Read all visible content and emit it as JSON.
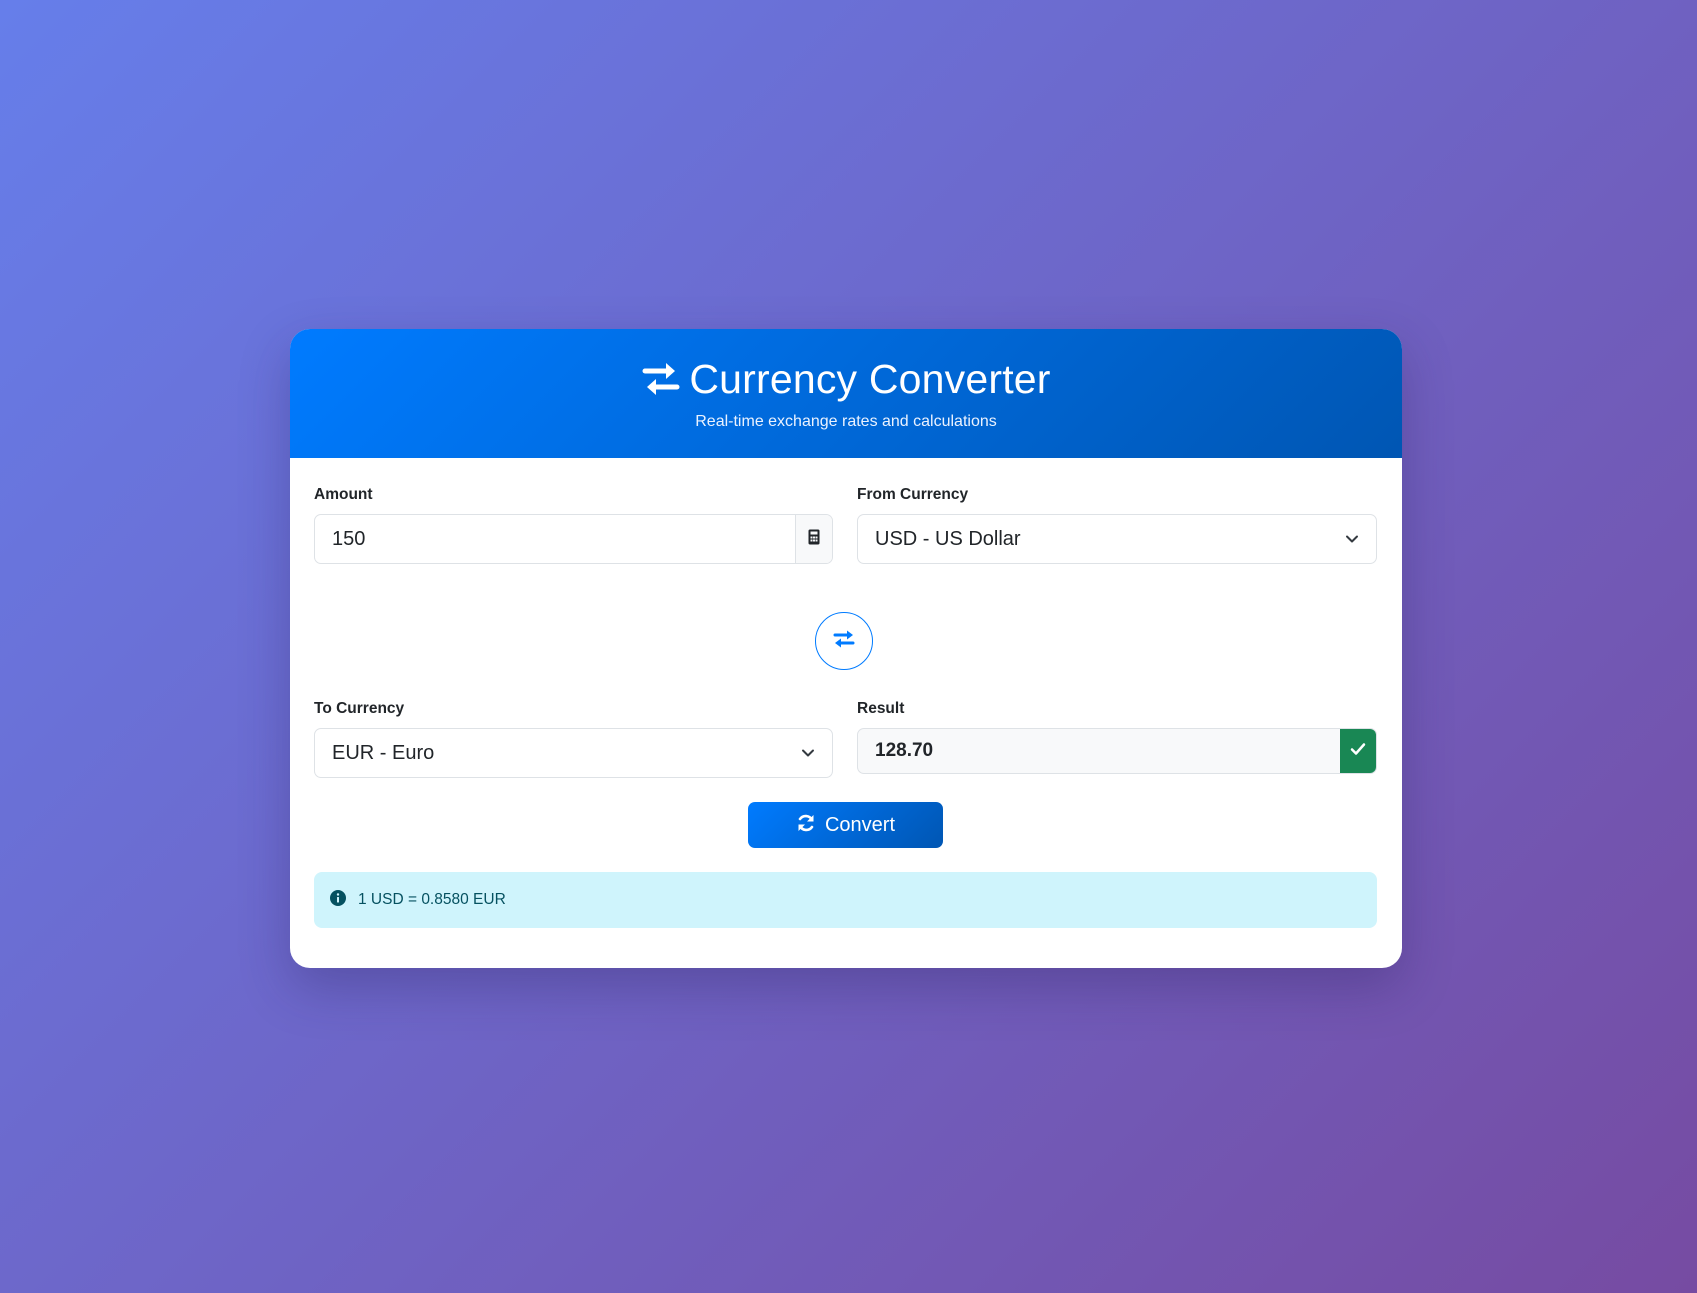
{
  "header": {
    "title": "Currency Converter",
    "subtitle": "Real-time exchange rates and calculations",
    "icon": "exchange-arrows-icon"
  },
  "form": {
    "amount": {
      "label": "Amount",
      "value": "150",
      "addon_icon": "calculator-icon"
    },
    "from_currency": {
      "label": "From Currency",
      "selected": "USD - US Dollar"
    },
    "swap_icon": "swap-arrows-icon",
    "to_currency": {
      "label": "To Currency",
      "selected": "EUR - Euro"
    },
    "result": {
      "label": "Result",
      "value": "128.70",
      "addon_icon": "check-icon"
    }
  },
  "convert_button": {
    "label": "Convert",
    "icon": "refresh-icon"
  },
  "rate_info": {
    "text": "1 USD = 0.8580 EUR",
    "icon": "info-circle-icon"
  },
  "colors": {
    "primary": "#007bff",
    "primary_dark": "#0056b3",
    "success": "#198754",
    "info_bg": "#cff4fc",
    "info_text": "#055160",
    "bg_gradient_start": "#667eea",
    "bg_gradient_end": "#764ba2"
  }
}
